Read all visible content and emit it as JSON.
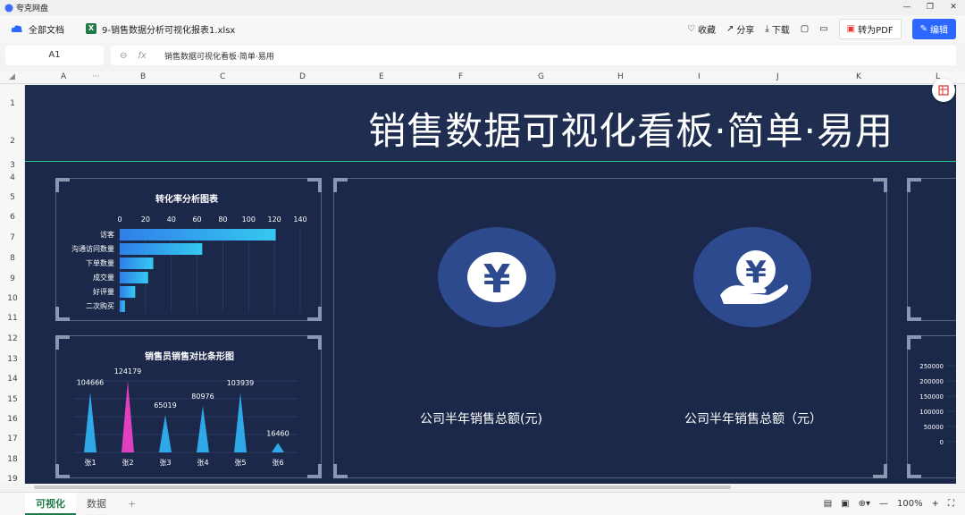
{
  "app": {
    "title": "夸克网盘"
  },
  "window": {
    "restore": "❐",
    "close": "✕"
  },
  "toolbar": {
    "all_docs": "全部文档",
    "file_name": "9-销售数据分析可视化报表1.xlsx",
    "xls_badge": "X",
    "favorite": "收藏",
    "share": "分享",
    "download": "下载",
    "to_pdf": "转为PDF",
    "edit": "编辑"
  },
  "formula": {
    "cell_ref": "A1",
    "fx_label": "fx",
    "content": "销售数据可视化看板·简单·易用"
  },
  "columns": [
    "A",
    "B",
    "C",
    "D",
    "E",
    "F",
    "G",
    "H",
    "I",
    "J",
    "K",
    "L"
  ],
  "rows": [
    "1",
    "2",
    "3",
    "4",
    "5",
    "6",
    "7",
    "8",
    "9",
    "10",
    "11",
    "12",
    "13",
    "14",
    "15",
    "16",
    "17",
    "18",
    "19"
  ],
  "dashboard": {
    "title": "销售数据可视化看板·简单·易用",
    "kpi1_label": "公司半年销售总额(元)",
    "kpi2_label": "公司半年销售总额（元）",
    "accent": "#29c98a",
    "circle_color": "#2d4a8f"
  },
  "chart_data": [
    {
      "type": "bar",
      "orientation": "horizontal",
      "title": "转化率分析图表",
      "categories": [
        "访客",
        "沟通访问数量",
        "下单数量",
        "成交量",
        "好评量",
        "二次购买"
      ],
      "values": [
        121,
        64,
        26,
        22,
        12,
        4
      ],
      "xlim": [
        0,
        140
      ],
      "xticks": [
        0,
        20,
        40,
        60,
        80,
        100,
        120,
        140
      ]
    },
    {
      "type": "bar",
      "title": "销售员销售对比条形图",
      "categories": [
        "张1",
        "张2",
        "张3",
        "张4",
        "张5",
        "张6"
      ],
      "values": [
        104666,
        124179,
        65019,
        80976,
        103939,
        16460
      ],
      "colors": [
        "#2fa8e8",
        "#e03fbf",
        "#2fa8e8",
        "#2fa8e8",
        "#2fa8e8",
        "#2fa8e8"
      ]
    },
    {
      "type": "bar",
      "title": "",
      "yticks": [
        250000,
        200000,
        150000,
        100000,
        50000,
        0
      ]
    }
  ],
  "sheets": [
    "可视化",
    "数据"
  ],
  "zoom": "100%"
}
